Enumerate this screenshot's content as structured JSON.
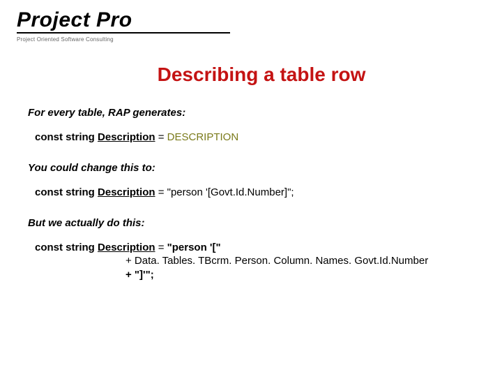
{
  "header": {
    "brand": "Project Pro",
    "tagline": "Project Oriented Software Consulting"
  },
  "title": "Describing a table row",
  "section1": {
    "intro": "For every table, RAP generates:",
    "kw": "const string",
    "ident": "Description",
    "eq": " = ",
    "val": "DESCRIPTION"
  },
  "section2": {
    "intro": "You could change this to:",
    "kw": "const string",
    "ident": "Description",
    "eq": " = ",
    "val": "\"person '[Govt.Id.Number]\";"
  },
  "section3": {
    "intro": "But we actually do this:",
    "kw": "const string",
    "ident": "Description",
    "eq": " = ",
    "l1": "\"person '[\"",
    "l2": "+ Data. Tables. TBcrm. Person. Column. Names. Govt.Id.Number",
    "l3": "+ \"]'\";"
  }
}
